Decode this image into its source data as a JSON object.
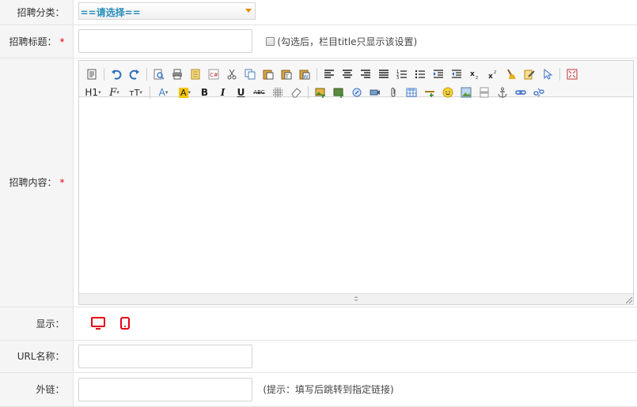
{
  "rows": {
    "category": {
      "label": "招聘分类：",
      "select_value": "==请选择=="
    },
    "title": {
      "label": "招聘标题：",
      "required_mark": "*",
      "checkbox_hint": "(勾选后，栏目title只显示该设置)"
    },
    "content": {
      "label": "招聘内容：",
      "required_mark": "*"
    },
    "display": {
      "label": "显示：",
      "icons": [
        "desktop-icon",
        "mobile-icon"
      ],
      "icon_color": "#e60012"
    },
    "url_name": {
      "label": "URL名称："
    },
    "external_link": {
      "label": "外链：",
      "hint": "(提示：填写后跳转到指定链接)"
    }
  },
  "toolbar": {
    "row1": [
      "source",
      "undo",
      "redo",
      "preview",
      "print",
      "template",
      "code",
      "cut",
      "copy",
      "paste",
      "paste-text",
      "paste-word",
      "align-left",
      "align-center",
      "align-right",
      "justify",
      "ordered-list",
      "unordered-list",
      "indent",
      "outdent",
      "subscript",
      "superscript",
      "clear-format",
      "select-all",
      "cursor",
      "fullscreen"
    ],
    "row2_text": {
      "heading": "H1",
      "font_family": "F",
      "font_size": "тT",
      "font_color": "A",
      "highlight": "A",
      "bold": "B",
      "italic": "I",
      "underline": "U",
      "strike": "ABC"
    }
  },
  "colors": {
    "accent": "#2a8fbd",
    "required": "#e60012",
    "label_bg": "#f5f5f5"
  }
}
